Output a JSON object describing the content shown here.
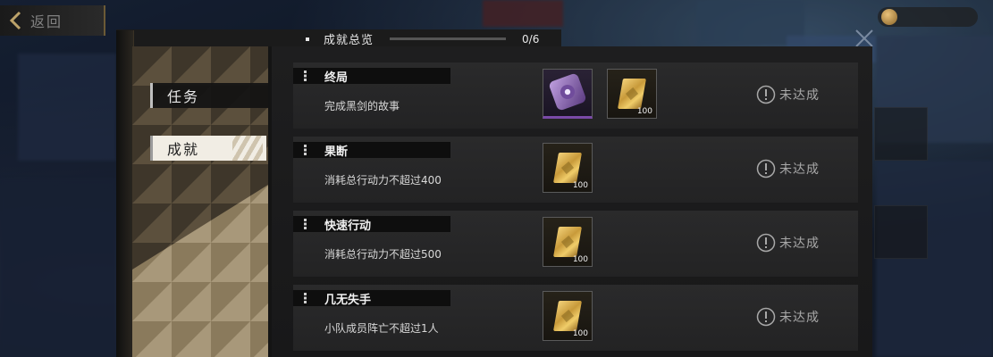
{
  "header": {
    "back_label": "返回",
    "panel_title": "成就总览",
    "progress_text": "0/6",
    "progress_fraction": 0
  },
  "nav": {
    "items": [
      {
        "label": "任务",
        "selected": false
      },
      {
        "label": "成就",
        "selected": true
      }
    ]
  },
  "achievements": [
    {
      "name": "终局",
      "description": "完成黑剑的故事",
      "rewards": [
        {
          "icon": "purple-disc-item-icon",
          "qty": ""
        },
        {
          "icon": "gold-ingot-icon",
          "qty": "100"
        }
      ],
      "status": "未达成"
    },
    {
      "name": "果断",
      "description": "消耗总行动力不超过400",
      "rewards": [
        {
          "icon": "gold-ingot-icon",
          "qty": "100"
        }
      ],
      "status": "未达成"
    },
    {
      "name": "快速行动",
      "description": "消耗总行动力不超过500",
      "rewards": [
        {
          "icon": "gold-ingot-icon",
          "qty": "100"
        }
      ],
      "status": "未达成"
    },
    {
      "name": "几无失手",
      "description": "小队成员阵亡不超过1人",
      "rewards": [
        {
          "icon": "gold-ingot-icon",
          "qty": "100"
        }
      ],
      "status": "未达成"
    }
  ],
  "colors": {
    "accent_gold": "#e0c070",
    "panel_dark": "#1e1e1f",
    "nav_tan": "#5a4e3c",
    "status_grey": "#a8a8a8"
  }
}
